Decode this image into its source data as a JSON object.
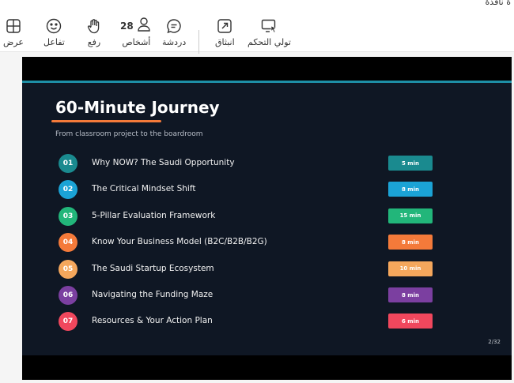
{
  "titlebar": {
    "title": "ة نافذة"
  },
  "toolbar": {
    "tools": [
      {
        "id": "view",
        "label": "عرض",
        "icon": "grid-icon"
      },
      {
        "id": "react",
        "label": "تفاعل",
        "icon": "smiley-icon"
      },
      {
        "id": "raise",
        "label": "رفع",
        "icon": "raised-hand-icon"
      },
      {
        "id": "people",
        "label": "أشخاص",
        "icon": "person-icon",
        "count": "28"
      },
      {
        "id": "chat",
        "label": "دردشة",
        "icon": "chat-bubble-icon"
      },
      {
        "id": "popout",
        "label": "انبثاق",
        "icon": "pop-out-icon"
      },
      {
        "id": "control",
        "label": "تولي التحكم",
        "icon": "screen-pointer-icon"
      }
    ]
  },
  "slide": {
    "title": "60-Minute Journey",
    "subtitle": "From classroom project to the boardroom",
    "page": "2/32",
    "colors": {
      "accent_top": "#1e8fa6",
      "underline": "#f47a3a",
      "background": "#0f1724"
    },
    "items": [
      {
        "num": "01",
        "label": "Why NOW? The Saudi Opportunity",
        "duration": "5 min",
        "color": "#1a8a8f"
      },
      {
        "num": "02",
        "label": "The Critical Mindset Shift",
        "duration": "8 min",
        "color": "#1ba3d6"
      },
      {
        "num": "03",
        "label": "5-Pillar Evaluation Framework",
        "duration": "15 min",
        "color": "#22b67a"
      },
      {
        "num": "04",
        "label": "Know Your Business Model (B2C/B2B/B2G)",
        "duration": "8 min",
        "color": "#f47a3a"
      },
      {
        "num": "05",
        "label": "The Saudi Startup Ecosystem",
        "duration": "10 min",
        "color": "#f5a75c"
      },
      {
        "num": "06",
        "label": "Navigating the Funding Maze",
        "duration": "8 min",
        "color": "#7b3fa0"
      },
      {
        "num": "07",
        "label": "Resources & Your Action Plan",
        "duration": "6 min",
        "color": "#f0475d"
      }
    ]
  }
}
